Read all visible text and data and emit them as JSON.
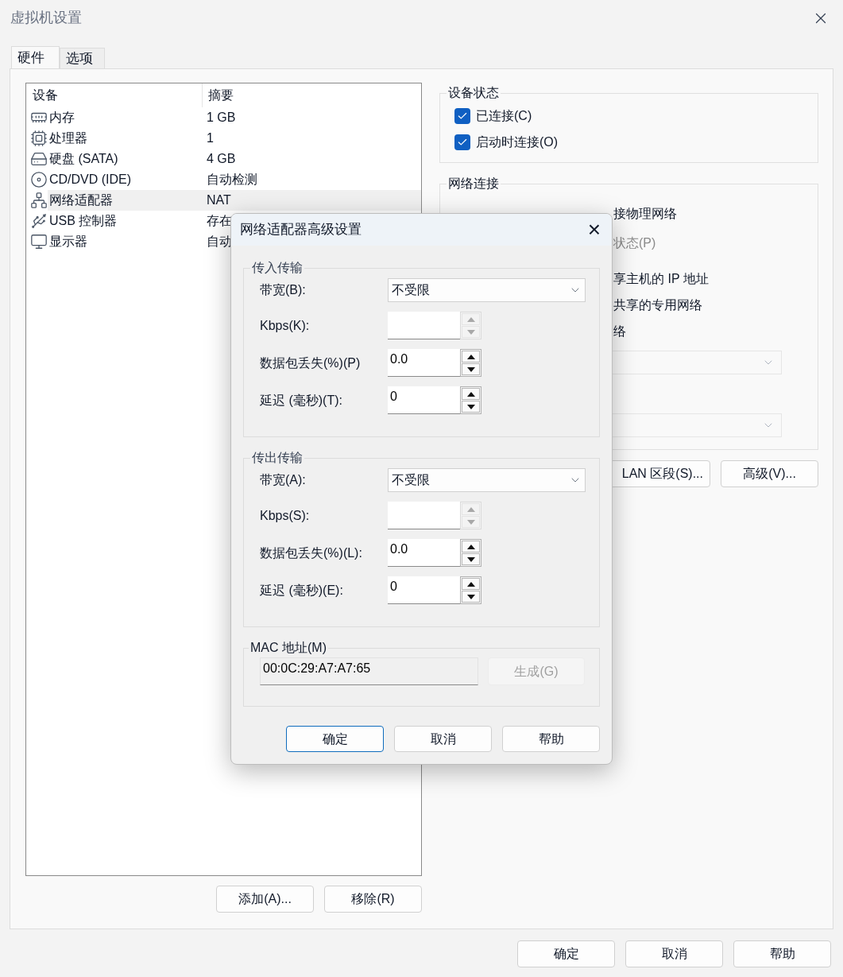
{
  "window": {
    "title": "虚拟机设置"
  },
  "tabs": [
    {
      "label": "硬件",
      "selected": true
    },
    {
      "label": "选项",
      "selected": false
    }
  ],
  "devices": {
    "columns": [
      "设备",
      "摘要"
    ],
    "rows": [
      {
        "kind": "memory",
        "name": "内存",
        "summary": "1 GB",
        "selected": false
      },
      {
        "kind": "cpu",
        "name": "处理器",
        "summary": "1",
        "selected": false
      },
      {
        "kind": "disk",
        "name": "硬盘 (SATA)",
        "summary": "4 GB",
        "selected": false
      },
      {
        "kind": "cd",
        "name": "CD/DVD (IDE)",
        "summary": "自动检测",
        "selected": false
      },
      {
        "kind": "network",
        "name": "网络适配器",
        "summary": "NAT",
        "selected": true
      },
      {
        "kind": "usb",
        "name": "USB 控制器",
        "summary": "存在",
        "selected": false
      },
      {
        "kind": "display",
        "name": "显示器",
        "summary": "自动",
        "selected": false
      }
    ]
  },
  "device_buttons": [
    "添加(A)...",
    "移除(R)"
  ],
  "device_status": {
    "title": "设备状态",
    "checkboxes": [
      {
        "label": "已连接(C)",
        "checked": true
      },
      {
        "label": "启动时连接(O)",
        "checked": true
      }
    ]
  },
  "network_connection": {
    "title": "网络连接",
    "options": [
      {
        "label": "接物理网络",
        "disabled": false
      },
      {
        "label": "状态(P)",
        "disabled": true
      },
      {
        "label": "享主机的 IP 地址",
        "disabled": false
      },
      {
        "label": "共享的专用网络",
        "disabled": false
      },
      {
        "label": "络",
        "disabled": false
      }
    ]
  },
  "network_buttons": [
    "LAN 区段(S)...",
    "高级(V)..."
  ],
  "footer_buttons": [
    "确定",
    "取消",
    "帮助"
  ],
  "dialog": {
    "title": "网络适配器高级设置",
    "close": "×",
    "groups": [
      {
        "title": "传入传输",
        "bandwidth_label": "带宽(B):",
        "bandwidth_value": "不受限",
        "fields": [
          {
            "label": "Kbps(K):",
            "disabled": true
          },
          {
            "label": "数据包丢失(%)(P)",
            "value": "0.0",
            "disabled": false
          },
          {
            "label": "延迟 (毫秒)(T):",
            "value": "0",
            "disabled": false
          }
        ]
      },
      {
        "title": "传出传输",
        "bandwidth_label": "带宽(A):",
        "bandwidth_value": "不受限",
        "fields": [
          {
            "label": "Kbps(S):",
            "disabled": true
          },
          {
            "label": "数据包丢失(%)(L):",
            "value": "0.0",
            "disabled": false
          },
          {
            "label": "延迟 (毫秒)(E):",
            "value": "0",
            "disabled": false
          }
        ]
      }
    ],
    "mac": {
      "title": "MAC 地址(M)",
      "value": "00:0C:29:A7:A7:65",
      "generate": {
        "label": "生成(G)",
        "disabled": true
      }
    },
    "buttons": [
      {
        "label": "确定",
        "default": true
      },
      {
        "label": "取消",
        "default": false
      },
      {
        "label": "帮助",
        "default": false
      }
    ]
  }
}
